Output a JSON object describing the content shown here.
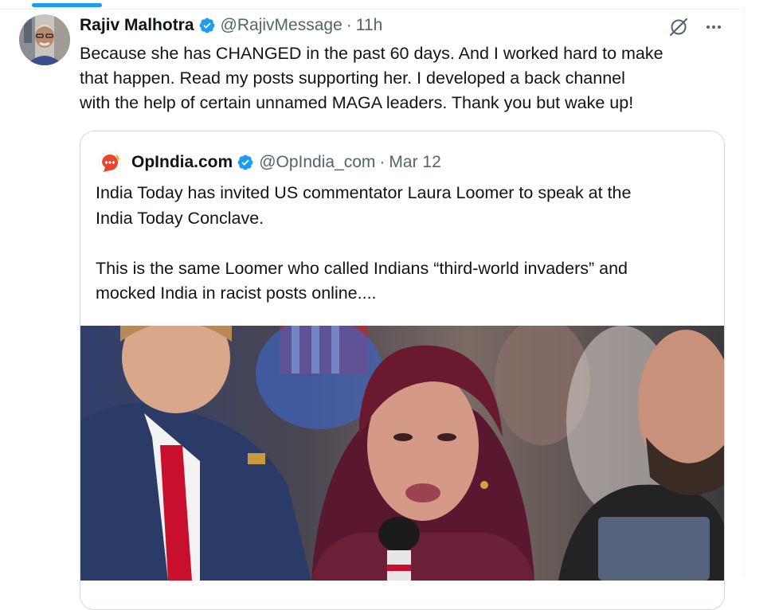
{
  "tweet": {
    "author_name": "Rajiv Malhotra",
    "handle": "@RajivMessage",
    "separator": "·",
    "time": "11h",
    "text_lines": [
      "Because she has CHANGED in the past 60 days. And I worked hard to make",
      "that happen. Read my posts supporting her. I developed a back channel",
      "with the help of certain unnamed  MAGA leaders. Thank you but wake up!"
    ]
  },
  "quoted": {
    "author_name": "OpIndia.com",
    "handle": "@OpIndia_com",
    "separator": "·",
    "time": "Mar 12",
    "paragraph1": [
      "India Today has invited US commentator Laura Loomer to speak at the",
      "India Today Conclave."
    ],
    "paragraph2": [
      "This is the same Loomer who called Indians “third-world invaders” and",
      "mocked India in racist posts online...."
    ]
  },
  "icons": {
    "verified": "verified-badge-icon",
    "grok": "grok-icon",
    "more": "more-icon",
    "logo": "opindia-logo-icon"
  },
  "colors": {
    "accent": "#1d9bf0",
    "secondary_text": "#536471",
    "border": "#cfd9de"
  }
}
